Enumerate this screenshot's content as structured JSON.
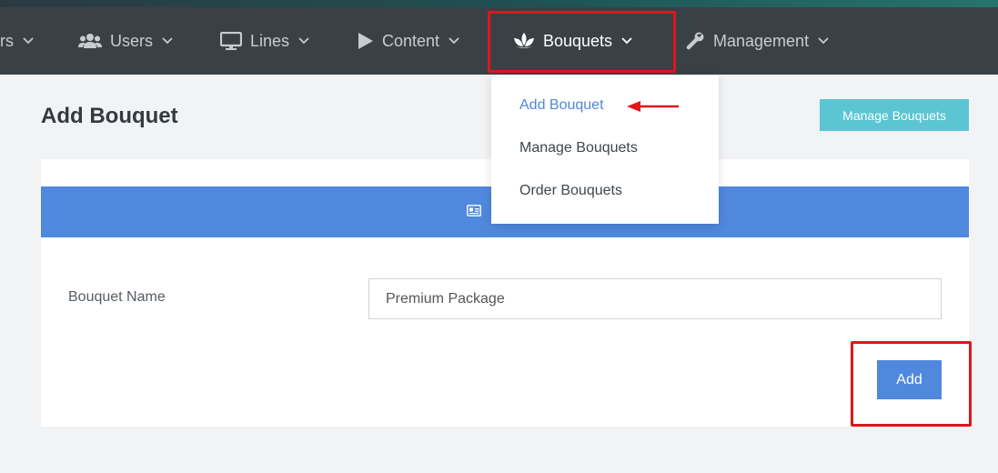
{
  "nav": {
    "items": [
      {
        "label": "rs",
        "icon": "",
        "active": false
      },
      {
        "label": "Users",
        "icon": "users-icon",
        "active": false
      },
      {
        "label": "Lines",
        "icon": "monitor-icon",
        "active": false
      },
      {
        "label": "Content",
        "icon": "play-icon",
        "active": false
      },
      {
        "label": "Bouquets",
        "icon": "lotus-icon",
        "active": true
      },
      {
        "label": "Management",
        "icon": "wrench-icon",
        "active": false
      }
    ]
  },
  "dropdown": {
    "items": [
      {
        "label": "Add Bouquet",
        "selected": true
      },
      {
        "label": "Manage Bouquets",
        "selected": false
      },
      {
        "label": "Order Bouquets",
        "selected": false
      }
    ]
  },
  "page": {
    "title": "Add Bouquet",
    "manage_button": "Manage Bouquets"
  },
  "form": {
    "header_icon": "id-card-icon",
    "bouquet_name_label": "Bouquet Name",
    "bouquet_name_value": "Premium Package",
    "add_button": "Add"
  },
  "colors": {
    "navbar": "#394147",
    "primary": "#4f88dc",
    "info": "#5bc5d3",
    "highlight": "#e0161b"
  }
}
